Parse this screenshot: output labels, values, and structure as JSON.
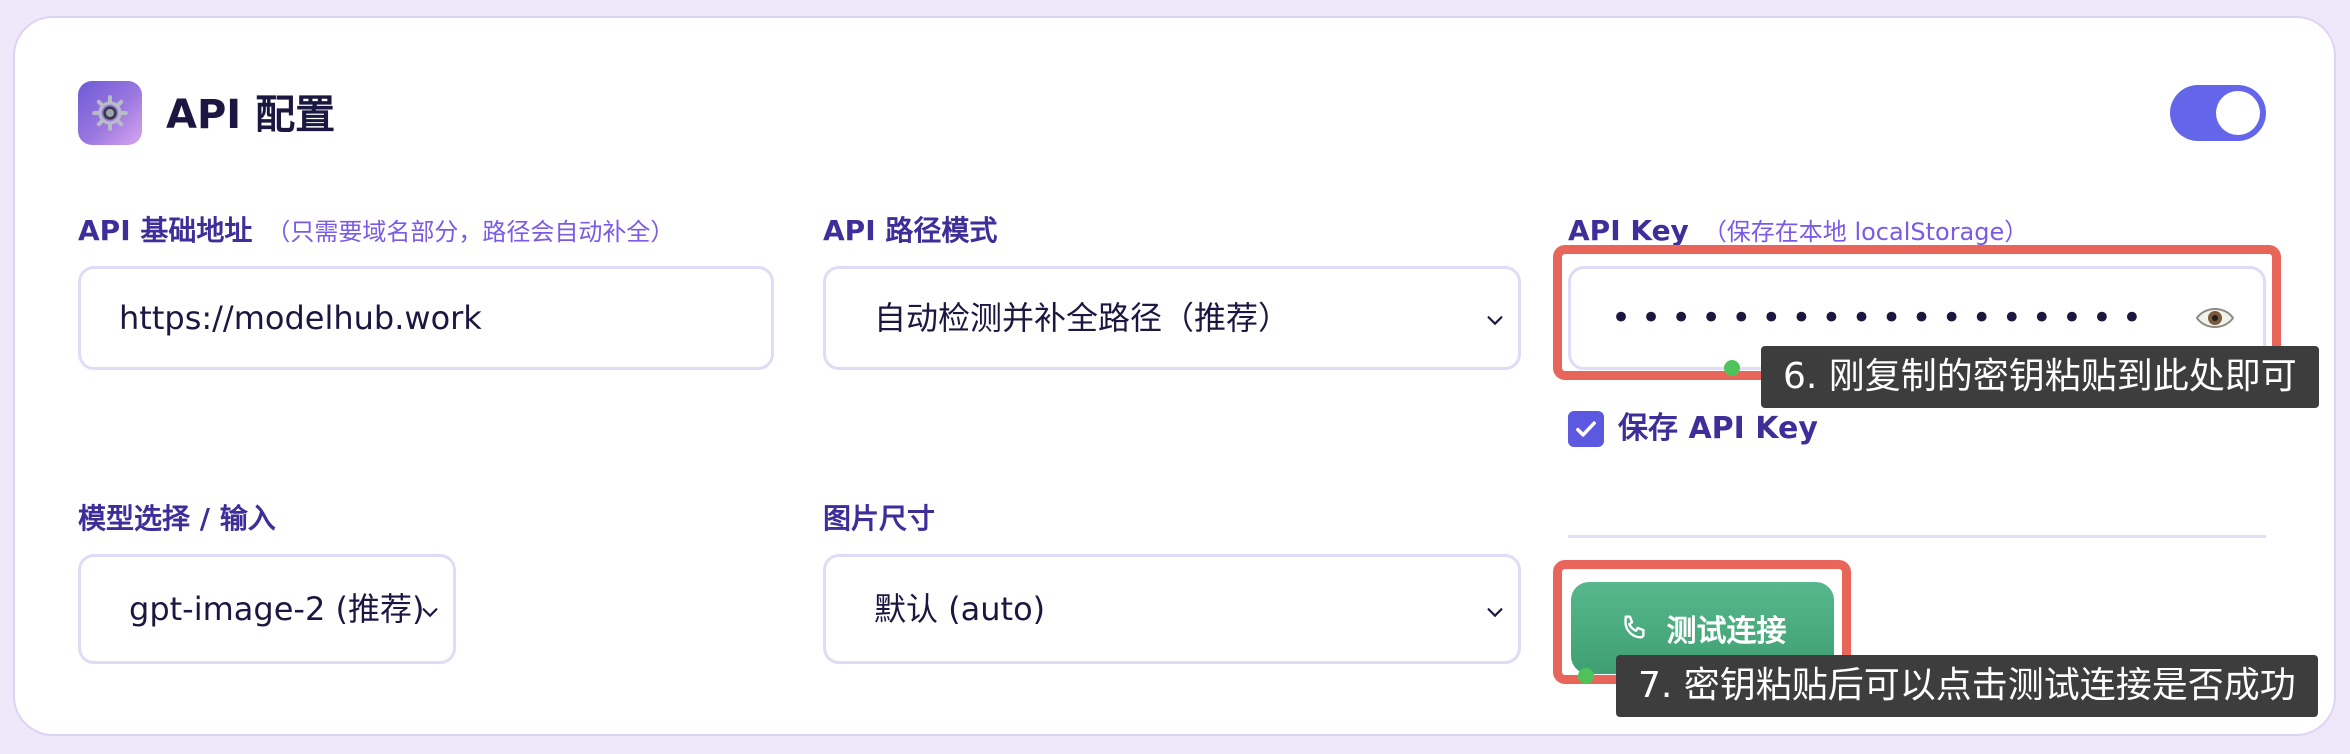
{
  "header": {
    "title": "API 配置",
    "icon": "gear-icon",
    "toggle_on": true
  },
  "fields": {
    "base_url": {
      "label": "API 基础地址",
      "hint": "（只需要域名部分，路径会自动补全）",
      "value": "https://modelhub.work"
    },
    "path_mode": {
      "label": "API 路径模式",
      "value": "自动检测并补全路径（推荐）"
    },
    "api_key": {
      "label": "API Key",
      "hint": "（保存在本地 localStorage）",
      "masked_value": "••••••••••••••••••",
      "reveal_icon": "eye-icon"
    },
    "save_key": {
      "label": "保存 API Key",
      "checked": true
    },
    "model": {
      "label": "模型选择 / 输入",
      "value": "gpt-image-2 (推荐)"
    },
    "image_size": {
      "label": "图片尺寸",
      "value": "默认 (auto)"
    }
  },
  "test_button": {
    "label": "测试连接",
    "icon": "phone-icon"
  },
  "annotations": {
    "step6": "6. 刚复制的密钥粘贴到此处即可",
    "step7": "7. 密钥粘贴后可以点击测试连接是否成功"
  },
  "colors": {
    "accent": "#6366e8",
    "label": "#3d2e9a",
    "hint": "#7a5ae6",
    "highlight": "#e8655a",
    "button": "#4aab7e",
    "tooltip_bg": "#3d3d3d"
  }
}
